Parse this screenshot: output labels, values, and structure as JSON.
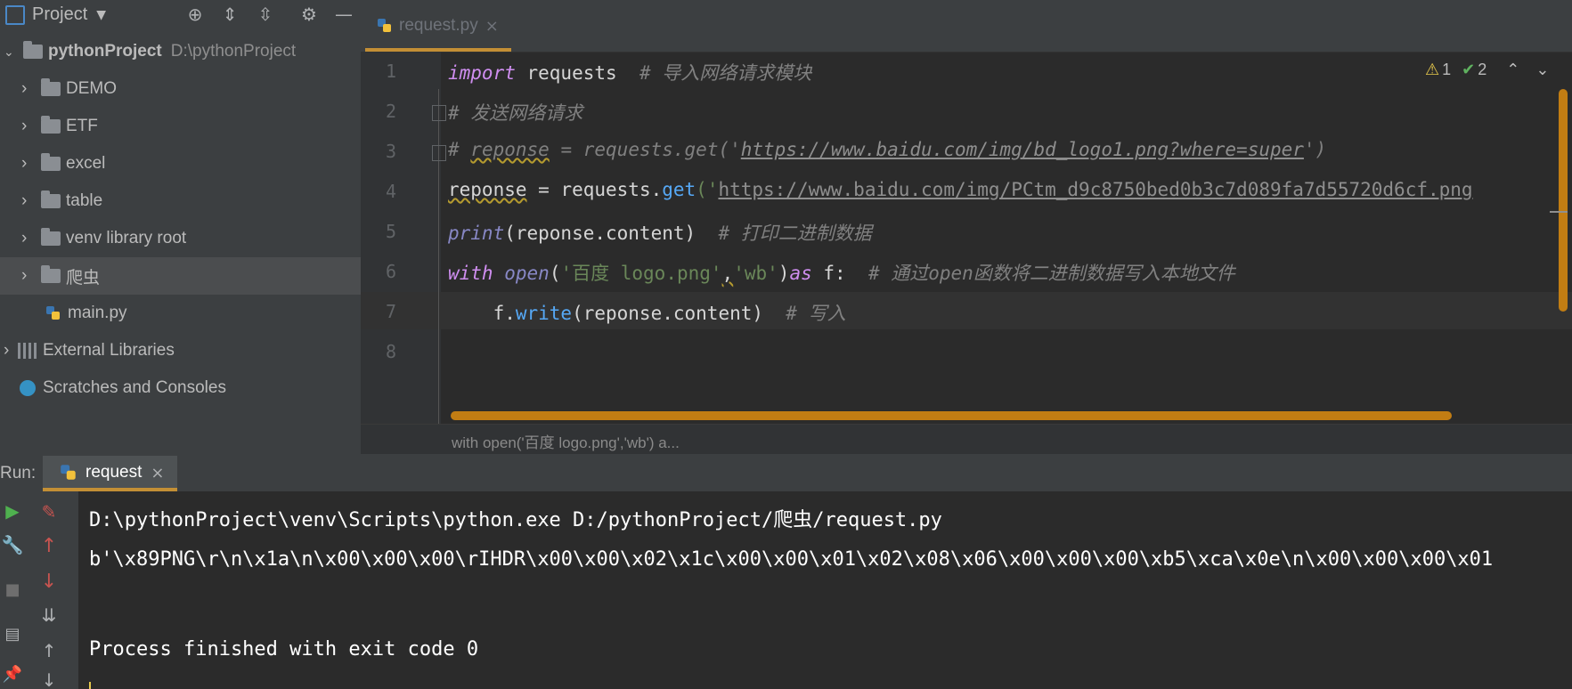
{
  "project_panel": {
    "title": "Project",
    "root": {
      "name": "pythonProject",
      "path": "D:\\pythonProject"
    },
    "items": [
      {
        "label": "DEMO"
      },
      {
        "label": "ETF"
      },
      {
        "label": "excel"
      },
      {
        "label": "table"
      },
      {
        "label": "venv  library root"
      },
      {
        "label": "爬虫"
      },
      {
        "label": "main.py"
      },
      {
        "label": "External Libraries"
      },
      {
        "label": "Scratches and Consoles"
      }
    ]
  },
  "editor": {
    "tab": {
      "label": "request.py"
    },
    "inspections": {
      "warnings": "1",
      "ok": "2"
    },
    "line_numbers": [
      "1",
      "2",
      "3",
      "4",
      "5",
      "6",
      "7",
      "8"
    ],
    "code": {
      "l1_kw": "import",
      "l1_mod": " requests  ",
      "l1_cm": "# 导入网络请求模块",
      "l2_cm": "# 发送网络请求",
      "l3_cm1": "# ",
      "l3_cm2": "reponse",
      "l3_cm3": " = requests.get('",
      "l3_url": "https://www.baidu.com/img/bd_logo1.png?where=super",
      "l3_cm4": "')",
      "l4_var": "reponse",
      "l4_a": " = requests.",
      "l4_get": "get",
      "l4_b": "('",
      "l4_url": "https://www.baidu.com/img/PCtm_d9c8750bed0b3c7d089fa7d55720d6cf.png",
      "l5_print": "print",
      "l5_a": "(reponse.content)  ",
      "l5_cm": "# 打印二进制数据",
      "l6_with": "with",
      "l6_sp": " ",
      "l6_open": "open",
      "l6_a": "(",
      "l6_s1": "'百度 logo.png'",
      "l6_comma": ",",
      "l6_s2": "'wb'",
      "l6_b": ")",
      "l6_as": "as",
      "l6_f": " f:  ",
      "l6_cm": "# 通过open函数将二进制数据写入本地文件",
      "l7_a": "    f.",
      "l7_write": "write",
      "l7_b": "(reponse.content)  ",
      "l7_cm": "# 写入"
    },
    "breadcrumb": "with open('百度 logo.png','wb') a..."
  },
  "run": {
    "label": "Run:",
    "tab": "request",
    "console": [
      "D:\\pythonProject\\venv\\Scripts\\python.exe D:/pythonProject/爬虫/request.py",
      "b'\\x89PNG\\r\\n\\x1a\\n\\x00\\x00\\x00\\rIHDR\\x00\\x00\\x02\\x1c\\x00\\x00\\x01\\x02\\x08\\x06\\x00\\x00\\x00\\xb5\\xca\\x0e\\n\\x00\\x00\\x00\\x01",
      "",
      "Process finished with exit code 0"
    ]
  },
  "colors": {
    "accent": "#c38f35",
    "scrollbar": "#c27d13",
    "panel_bg": "#3c3f41",
    "editor_bg": "#2b2b2b"
  }
}
